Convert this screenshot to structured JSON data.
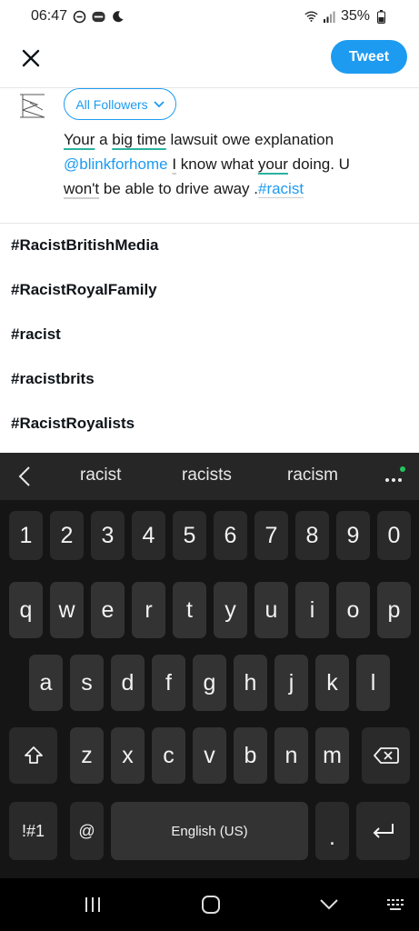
{
  "status_bar": {
    "time": "06:47",
    "left_icons": [
      "do-not-disturb-icon",
      "news-app-icon",
      "moon-icon"
    ],
    "battery": "35%",
    "right_icons": [
      "wifi-icon",
      "signal-icon",
      "battery-icon"
    ]
  },
  "top_bar": {
    "close_icon": "close-icon",
    "tweet_label": "Tweet",
    "accent": "#1d9bf0"
  },
  "composer": {
    "audience_label": "All Followers",
    "text": {
      "w_your1": "Your",
      "w_a": " a ",
      "w_bigtime": "big time",
      "w_rest1": " lawsuit owe explanation",
      "w_mention": "@blinkforhome",
      "w_space1": " ",
      "w_i": "I",
      "w_know": " know what ",
      "w_your2": "your",
      "w_doing": " doing. U",
      "w_wont": "won't",
      "w_drive": " be able to drive away .",
      "w_hashtag": "#racist"
    }
  },
  "suggestions": [
    "#RacistBritishMedia",
    "#RacistRoyalFamily",
    "#racist",
    "#racistbrits",
    "#RacistRoyalists"
  ],
  "keyboard": {
    "predictions": [
      "racist",
      "racists",
      "racism"
    ],
    "number_row": [
      "1",
      "2",
      "3",
      "4",
      "5",
      "6",
      "7",
      "8",
      "9",
      "0"
    ],
    "row1": [
      "q",
      "w",
      "e",
      "r",
      "t",
      "y",
      "u",
      "i",
      "o",
      "p"
    ],
    "row2": [
      "a",
      "s",
      "d",
      "f",
      "g",
      "h",
      "j",
      "k",
      "l"
    ],
    "row3": [
      "z",
      "x",
      "c",
      "v",
      "b",
      "n",
      "m"
    ],
    "symbols_label": "!#1",
    "at_label": "@",
    "space_label": "English (US)",
    "period_label": "."
  }
}
